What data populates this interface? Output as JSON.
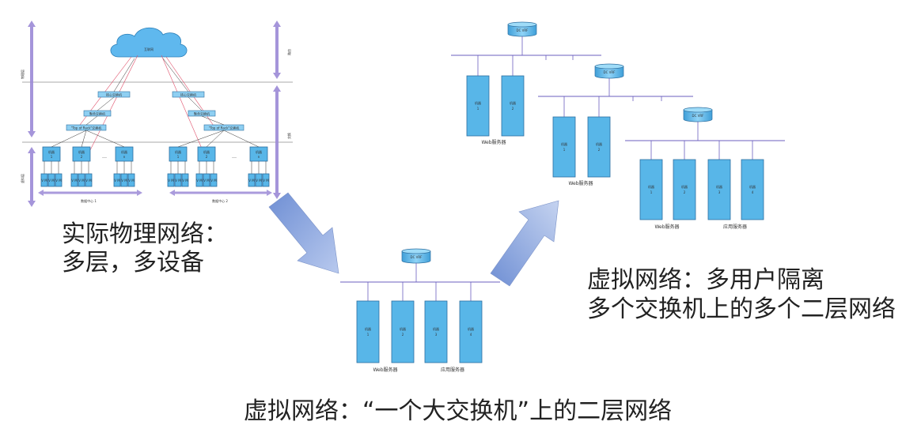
{
  "captions": {
    "physical_title": "实际物理网络：",
    "physical_sub": "多层，多设备",
    "virtual_multi_title": "虚拟网络：多用户隔离",
    "virtual_multi_sub": "多个交换机上的多个二层网络",
    "virtual_single": "虚拟网络：“一个大交换机”上的二层网络"
  },
  "physical": {
    "cloud_label": "互联网",
    "core_left": "核心交换机",
    "core_right": "核心交换机",
    "agg_left": "聚合交换机",
    "agg_right": "聚合交换机",
    "tor_left": "\"Top of Rack\"交换机",
    "tor_right": "\"Top of Rack\"交换机",
    "machine_label": "机器",
    "machine_nums": [
      "1",
      "2",
      "n",
      "1",
      "2",
      "n"
    ],
    "vm_label": "V M",
    "ellipsis": "…",
    "dc1": "数据中心 1",
    "dc2": "数据中心 2",
    "side_top_right": "路由",
    "side_mid_left": "物理层",
    "side_bottom_left": "虚拟层",
    "side_mid_right": "交换"
  },
  "vrf_label": "DC VRF",
  "machine_label": "机器",
  "web_servers": "Web服务器",
  "app_servers": "应用服务器",
  "machine_nums_2": [
    "1",
    "2"
  ],
  "machine_nums_4": [
    "1",
    "2",
    "3",
    "4"
  ],
  "colors": {
    "machine_fill": "#58b6e8",
    "arrow_fill": "#8fa8dc",
    "purple": "#9b8ad6",
    "bus_line": "#6b5fbf",
    "cloud": "#5fb8ee"
  }
}
